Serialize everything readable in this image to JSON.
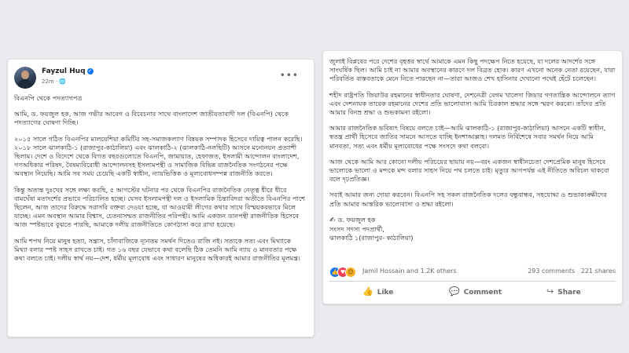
{
  "post": {
    "author": "Fayzul Huq",
    "time": "22m",
    "privacy_icon": "globe-icon"
  },
  "left_text": {
    "p1": "বিএনপি থেকে পদত্যাগপত্র",
    "p2": "আমি, ড. ফয়জুল হক, আজ গভীর আবেগ ও বিবেচনার সাথে বাংলাদেশ জাতীয়তাবাদী দল (বিএনপি) থেকে পদত্যাগের ঘোষণা দিচ্ছি।",
    "p3": "২০১৫ সালে গঠিত বিএনপির মালয়েশিয়া কমিটির সহ-সমাজকল্যাণ বিষয়ক সম্পাদক হিসেবে দায়িত্ব পালন করেছি। ২০১৮ সালে ঝালকাঠি-১ (রাজাপুর-কাঠালিয়া) এবং ঝালকাঠি-২ (ঝালকাঠি-নলছিটি) আসনে মনোনয়ন প্রত্যাশী ছিলাম। দেশে ও বিদেশে থেকে বিগত বছরগুলোতে বিএনপি, জামায়াত, হেফাজত, ইসলামী আন্দোলন বাংলাদেশ, গণঅধিকার পরিষদ, বৈষম্যবিরোধী আন্দোলনসহ ইসলামপন্থী ও সামাজিক বিভিন্ন রাজনৈতিক সংগঠনের পক্ষে অবস্থান নিয়েছি। আমি সব সময় চেয়েছি একটি স্বাধীন, ন্যায়ভিত্তিক ও মূল্যবোধসম্পন্ন রাজনীতি করতে।",
    "p4": "কিন্তু অত্যন্ত দুঃখের সঙ্গে লক্ষ্য করছি, ৫ আগস্টের ঘটনার পর থেকে বিএনপির রাজনৈতিক নেতৃত্ব ধীরে ধীরে বামঘেঁষা মতাদর্শের প্রভাবে পরিচালিত হচ্ছে। যেসব ইসলামপন্থী দল ও ইসলামিক চিন্তাবিদরা অতীতে বিএনপির পাশে ছিলেন, আজ তাদের বিরুদ্ধে সরাসরি বক্তব্য দেওয়া হচ্ছে, যা আওয়ামী লীগের কথার সাথে বিস্ময়করভাবে মিলে যাচ্ছে। এমন অবস্থান আমার বিশ্বাস, চেতনাসম্মত রাজনীতির পরিপন্থী। আমি একজন ডানপন্থী রাজনীতিক হিসেবে আজ স্পষ্টভাবে বুঝতে পারছি, আমাকে দলীয় রাজনীতিতে কোণঠাসা করে রাখা হয়েছে।",
    "p5": "আমি শপথ নিয়ে মানুষ হত্যা, সন্ত্রাস, চাঁদাবাজিকে ন্যূনতম সমর্থন দিতেও রাজি নই। সত্যকে সত্য এবং মিথ্যাকে মিথ্যা বলার স্পষ্ট সাহস রাখতে চাই। গত ১৬ বছর যেভাবে কথা বলেছি ঠিক তেমনি আমি ন্যায় ও মানবতার পক্ষে কথা বলতে চাই। দলীয় স্বার্থ নয়—দেশ, ধর্মীয় মূল্যবোধ এবং সাধারণ মানুষের অধিকারই আমার রাজনীতির মূলমন্ত্র।"
  },
  "right_text": {
    "p1": "জুলাই বিপ্লবের পরে দেশের বৃহত্তর স্বার্থে আমাকে এমন কিছু পদক্ষেপ নিতে হয়েছে, যা দলের আদর্শের সঙ্গে সাংঘর্ষিক ছিল। আমি চাই না আমার অবস্থানের কারণে দল বিব্রত হোক। কারণ এখনো অনেক নেতা রয়েছেন, যারা পরিবর্তিত বাস্তবতাকে মেনে নিতে পারছেন না—তারা আজও শেখ হাসিনার দেখানো পথেই হেঁটে চলেছেন।",
    "p2": "শহীদ রাষ্ট্রপতি জিয়াউর রহমানের স্বাধীনতার ঘোষণা, দেশনেত্রী বেগম খালেদা জিয়ার গণতান্ত্রিক আন্দোলনে ত্যাগ এবং দেশনায়ক তারেক রহমানের দেশের প্রতি ভালোবাসা আমি চিরকাল শ্রদ্ধার সঙ্গে স্মরণ করবো। তাঁদের প্রতি আমার বিনম্র শ্রদ্ধা ও শুভকামনা রইলো।",
    "p3": "আমার রাজনৈতিক ভবিষ্যৎ বিষয়ে বলতে চাই—আমি ঝালকাঠি-১ (রাজাপুর-কাঠালিয়া) আসনে একটি স্বাধীন, স্বতন্ত্র প্রার্থী হিসেবে জাতির সামনে আসতে যাচ্ছি ইনশাআল্লাহ। দলমত নির্বিশেষে সবার সমর্থন নিয়ে আমি মানবতা, সত্য এবং ধর্মীয় মূল্যবোধের পক্ষে সংসদে কথা বলবো।",
    "p4": "আজ থেকে আমি আর কোনো দলীয় পরিচয়ের ছায়ায় নয়—বরং একজন স্বাধীনচেতা দেশপ্রেমিক মানুষ হিসেবে ভালোকে ভালো ও মন্দকে মন্দ বলার সাহস নিয়ে পথ চলতে চাই। মৃত্যুর আগপর্যন্ত এই নীতিতে অবিচল থাকবো বলে দৃঢ়প্রতিজ্ঞ।",
    "p5": "সবাই আমার জন্য দোয়া করবেন। বিএনপি সহ সকল রাজনৈতিক দলের বন্ধুবান্ধব, সহযোদ্ধা ও শুভাকাঙ্ক্ষীদের প্রতি আমার আন্তরিক ভালোবাসা ও শ্রদ্ধা রইলো।",
    "sig_name": "ড. ফয়জুল হক",
    "sig_title": "সংসদ সদস্য পদপ্রার্থী,",
    "sig_area": "ঝালকাঠি ১(রাজাপুর- কাঠালিয়া)"
  },
  "engagement": {
    "reaction_names": "Jamil Hossain and 1.2K others",
    "comments": "293 comments",
    "shares": "221 shares",
    "like_label": "Like",
    "comment_label": "Comment",
    "share_label": "Share"
  }
}
